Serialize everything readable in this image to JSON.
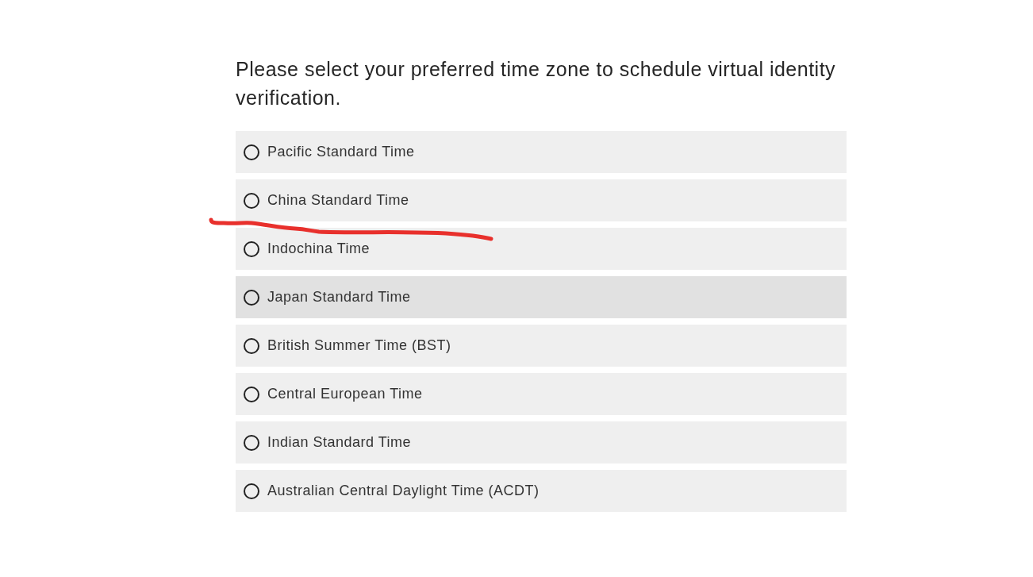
{
  "prompt": "Please select your preferred time zone to schedule virtual identity verification.",
  "options": [
    {
      "label": "Pacific Standard Time",
      "selected": false,
      "hovered": false
    },
    {
      "label": "China Standard Time",
      "selected": false,
      "hovered": false
    },
    {
      "label": "Indochina Time",
      "selected": false,
      "hovered": false
    },
    {
      "label": "Japan Standard Time",
      "selected": false,
      "hovered": true
    },
    {
      "label": "British Summer Time (BST)",
      "selected": false,
      "hovered": false
    },
    {
      "label": "Central European Time",
      "selected": false,
      "hovered": false
    },
    {
      "label": "Indian Standard Time",
      "selected": false,
      "hovered": false
    },
    {
      "label": "Australian Central Daylight Time (ACDT)",
      "selected": false,
      "hovered": false
    }
  ],
  "markup": {
    "kind": "freehand-underline"
  }
}
